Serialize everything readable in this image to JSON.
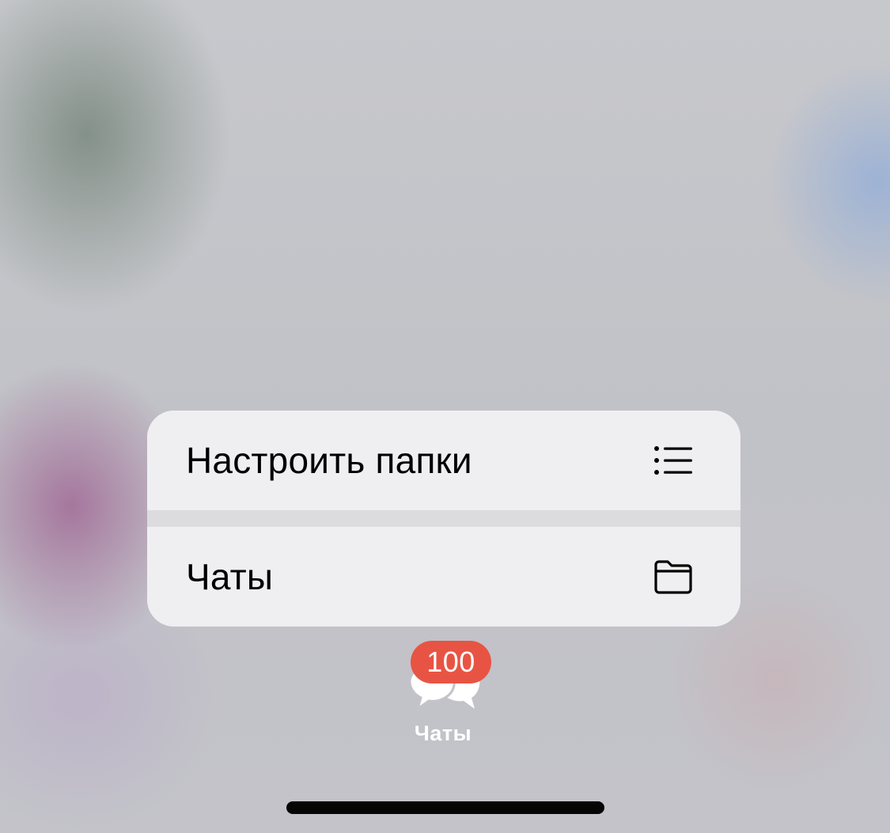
{
  "context_menu": {
    "items": [
      {
        "label": "Настроить папки",
        "icon": "list-icon"
      },
      {
        "label": "Чаты",
        "icon": "folder-icon"
      }
    ]
  },
  "tab_bar": {
    "chats_tab": {
      "label": "Чаты",
      "icon": "chat-bubbles-icon",
      "badge": "100",
      "badge_color": "#e85443"
    }
  },
  "colors": {
    "menu_background": "#efeff1",
    "separator": "#dcdcde",
    "home_indicator": "#050505"
  }
}
